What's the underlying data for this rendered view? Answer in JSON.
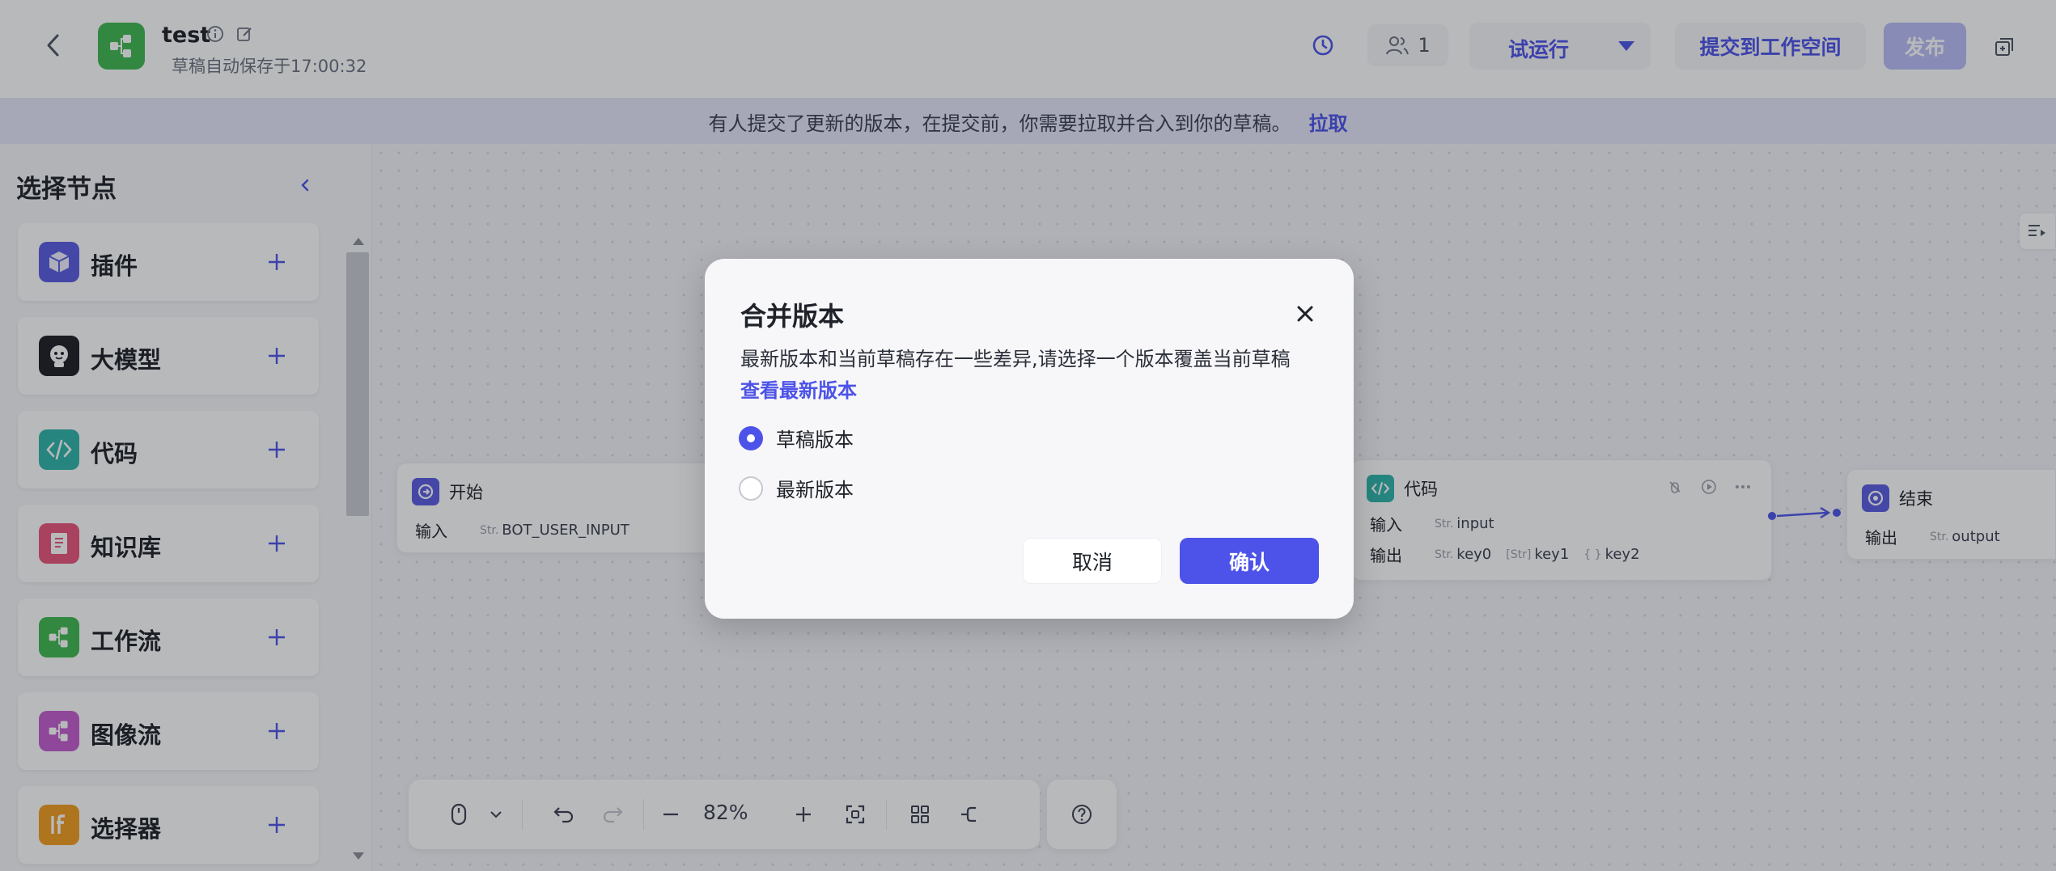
{
  "header": {
    "title": "test",
    "save_status": "草稿自动保存于17:00:32",
    "collaborators": "1",
    "trial_run_label": "试运行",
    "submit_label": "提交到工作空间",
    "publish_label": "发布"
  },
  "banner": {
    "message": "有人提交了更新的版本，在提交前，你需要拉取并合入到你的草稿。",
    "link": "拉取"
  },
  "sidebar": {
    "title": "选择节点",
    "items": [
      {
        "label": "插件",
        "icon": "cube-icon",
        "color": "#5b5ce2"
      },
      {
        "label": "大模型",
        "icon": "robot-icon",
        "color": "#1f1f24"
      },
      {
        "label": "代码",
        "icon": "code-icon",
        "color": "#2fb5a8"
      },
      {
        "label": "知识库",
        "icon": "book-icon",
        "color": "#e8557a"
      },
      {
        "label": "工作流",
        "icon": "workflow-icon",
        "color": "#3fb950"
      },
      {
        "label": "图像流",
        "icon": "image-flow-icon",
        "color": "#c45ccf"
      },
      {
        "label": "选择器",
        "icon": "if-icon",
        "color": "#f29d1f"
      }
    ]
  },
  "canvas": {
    "start_node": {
      "title": "开始",
      "input_label": "输入",
      "input_var": "BOT_USER_INPUT",
      "type": "Str."
    },
    "code_node": {
      "title": "代码",
      "input_label": "输入",
      "input_var": "input",
      "output_label": "输出",
      "outputs": [
        {
          "type": "Str.",
          "name": "key0"
        },
        {
          "type": "[Str]",
          "name": "key1"
        },
        {
          "type": "{ }",
          "name": "key2"
        }
      ]
    },
    "end_node": {
      "title": "结束",
      "output_label": "输出",
      "output_var": "output",
      "type": "Str."
    }
  },
  "toolbar": {
    "zoom": "82%"
  },
  "dialog": {
    "title": "合并版本",
    "description": "最新版本和当前草稿存在一些差异,请选择一个版本覆盖当前草稿",
    "link": "查看最新版本",
    "options": [
      {
        "label": "草稿版本",
        "checked": true
      },
      {
        "label": "最新版本",
        "checked": false
      }
    ],
    "cancel": "取消",
    "confirm": "确认"
  },
  "colors": {
    "accent": "#4d53e8",
    "publish_disabled": "#b9bdf6",
    "banner_bg": "#e5e7fb"
  }
}
